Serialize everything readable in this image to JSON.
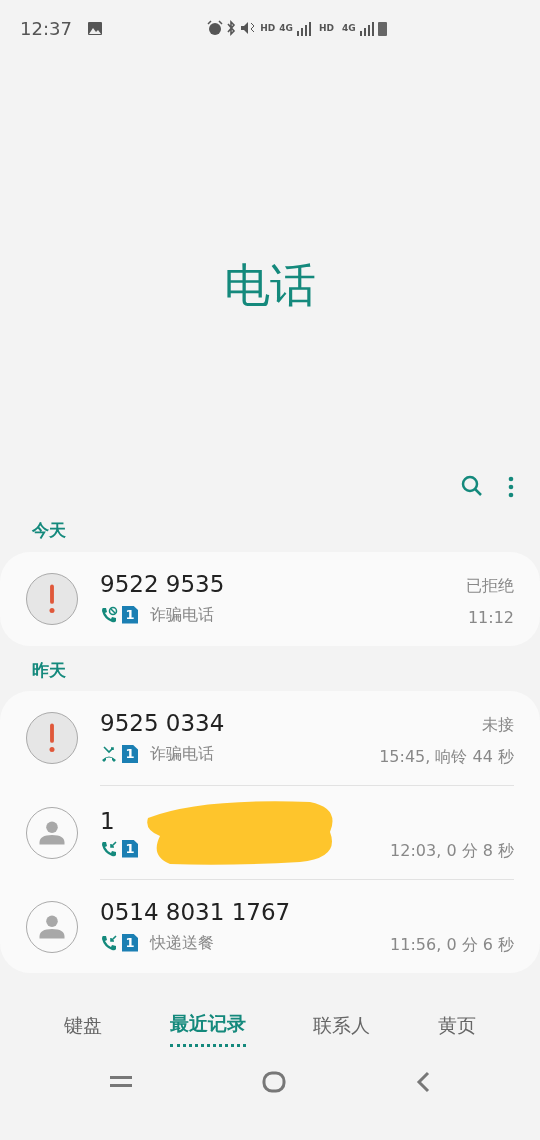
{
  "status_bar": {
    "time": "12:37",
    "network_labels": [
      "HD",
      "4G",
      "HD",
      "4G"
    ]
  },
  "title": "电话",
  "groups": [
    {
      "header": "今天",
      "calls": [
        {
          "avatar": {
            "kind": "spam"
          },
          "call_icon": {
            "kind": "rejected"
          },
          "number": "9522 9535",
          "sim": "1",
          "label": "诈骗电话",
          "status": "已拒绝",
          "time": "11:12",
          "redacted": false
        }
      ]
    },
    {
      "header": "昨天",
      "calls": [
        {
          "avatar": {
            "kind": "spam"
          },
          "call_icon": {
            "kind": "missed"
          },
          "number": "9525 0334",
          "sim": "1",
          "label": "诈骗电话",
          "status": "未接",
          "time": "15:45, 响铃 44 秒",
          "redacted": false
        },
        {
          "avatar": {
            "kind": "contact"
          },
          "call_icon": {
            "kind": "incoming"
          },
          "number": "1",
          "sim": "1",
          "time": "12:03, 0 分 8 秒",
          "redacted": true
        },
        {
          "avatar": {
            "kind": "contact"
          },
          "call_icon": {
            "kind": "incoming"
          },
          "number": "0514 8031 1767",
          "sim": "1",
          "label": "快递送餐",
          "time": "11:56, 0 分 6 秒",
          "redacted": false
        }
      ]
    }
  ],
  "tabs": [
    {
      "label": "键盘",
      "selected": false
    },
    {
      "label": "最近记录",
      "selected": true
    },
    {
      "label": "联系人",
      "selected": false
    },
    {
      "label": "黄页",
      "selected": false
    }
  ]
}
